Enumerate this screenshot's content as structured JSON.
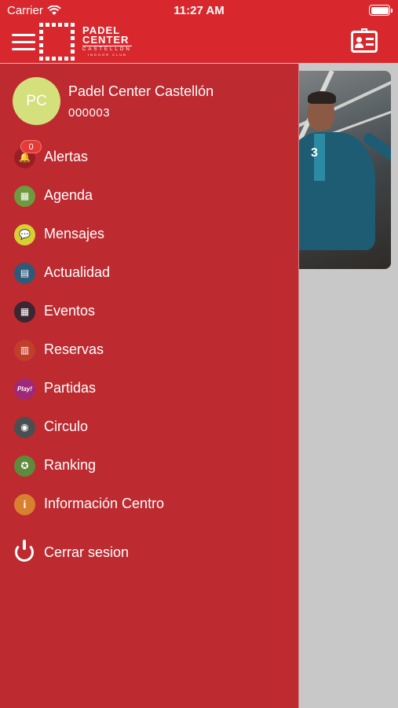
{
  "status_bar": {
    "carrier": "Carrier",
    "time": "11:27 AM"
  },
  "brand": {
    "line1": "Padel",
    "line2": "Center",
    "line3": "Castellón",
    "line4": "Indoor Club"
  },
  "profile": {
    "initials": "PC",
    "name": "Padel Center Castellón",
    "code": "000003"
  },
  "menu": [
    {
      "label": "Alertas",
      "icon": "bell-icon",
      "color": "#9a1f24",
      "glyph": "🔔"
    },
    {
      "label": "Agenda",
      "icon": "calendar-icon",
      "color": "#6e9a3f",
      "glyph": "▦"
    },
    {
      "label": "Mensajes",
      "icon": "chat-icon",
      "color": "#d6cf33",
      "glyph": "💬"
    },
    {
      "label": "Actualidad",
      "icon": "news-icon",
      "color": "#2e5a78",
      "glyph": "▤"
    },
    {
      "label": "Eventos",
      "icon": "event-calendar-icon",
      "color": "#3b2632",
      "glyph": "▦"
    },
    {
      "label": "Reservas",
      "icon": "court-icon",
      "color": "#c03f2a",
      "glyph": "▥"
    },
    {
      "label": "Partidas",
      "icon": "play-icon",
      "color": "#a02878",
      "glyph": "Play!"
    },
    {
      "label": "Circulo",
      "icon": "group-icon",
      "color": "#4a5052",
      "glyph": "◉"
    },
    {
      "label": "Ranking",
      "icon": "award-icon",
      "color": "#5f8a3c",
      "glyph": "✪"
    },
    {
      "label": "Información Centro",
      "icon": "info-icon",
      "color": "#d9802f",
      "glyph": "i"
    }
  ],
  "alerts_badge": "0",
  "logout": {
    "label": "Cerrar sesion",
    "icon": "power-icon"
  },
  "colors": {
    "primary": "#d8282d",
    "drawer": "#bd2a30",
    "avatar": "#d4e07c"
  }
}
